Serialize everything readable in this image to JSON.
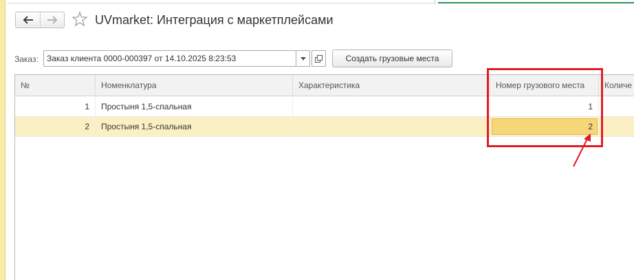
{
  "window": {
    "title": "UVmarket: Интеграция с маркетплейсами"
  },
  "order": {
    "label": "Заказ:",
    "value": "Заказ клиента 0000-000397 от 14.10.2025 8:23:53"
  },
  "toolbar": {
    "create_button_label": "Создать грузовые места"
  },
  "table": {
    "columns": [
      "№",
      "Номенклатура",
      "Характеристика",
      "Номер грузового места",
      "Количе"
    ],
    "rows": [
      {
        "n": "1",
        "item": "Простыня 1,5-спальная",
        "characteristic": "",
        "cargo_place": "1"
      },
      {
        "n": "2",
        "item": "Простыня 1,5-спальная",
        "characteristic": "",
        "cargo_place": "2"
      }
    ],
    "selected_row_index": 1
  },
  "icons": {
    "back": "arrow-left-icon",
    "forward": "arrow-right-icon",
    "favorite": "star-icon",
    "dropdown": "chevron-down-icon",
    "open": "open-form-icon"
  },
  "colors": {
    "selected_row": "#fbf0c4",
    "active_cell": "#f5d77a",
    "annotation": "#e01b24",
    "header_bg": "#f2f2f2"
  }
}
